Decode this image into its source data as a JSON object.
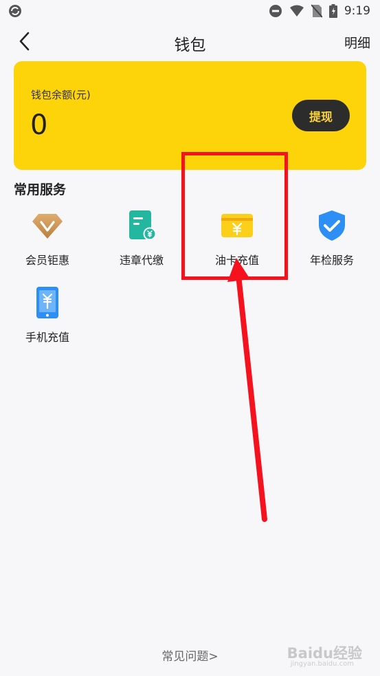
{
  "status_bar": {
    "time": "9:19",
    "icons": [
      "sync-icon",
      "dnd-icon",
      "wifi-icon",
      "no-sim-icon",
      "battery-icon"
    ]
  },
  "nav": {
    "title": "钱包",
    "detail_label": "明细",
    "back_icon": "chevron-left-icon"
  },
  "wallet": {
    "balance_label": "钱包余额(元)",
    "balance_value": "0",
    "withdraw_label": "提现",
    "card_color": "#fdd30a"
  },
  "services": {
    "section_title": "常用服务",
    "items": [
      {
        "label": "会员钜惠",
        "icon": "diamond-icon"
      },
      {
        "label": "违章代缴",
        "icon": "document-yuan-icon"
      },
      {
        "label": "油卡充值",
        "icon": "card-yuan-icon"
      },
      {
        "label": "年检服务",
        "icon": "shield-check-icon"
      },
      {
        "label": "手机充值",
        "icon": "phone-yuan-icon"
      }
    ]
  },
  "footer": {
    "faq_label": "常见问题>"
  },
  "watermark": {
    "text": "Baidu经验",
    "sub": "jingyan.baidu.com"
  },
  "annotation_color": "#f5121e"
}
